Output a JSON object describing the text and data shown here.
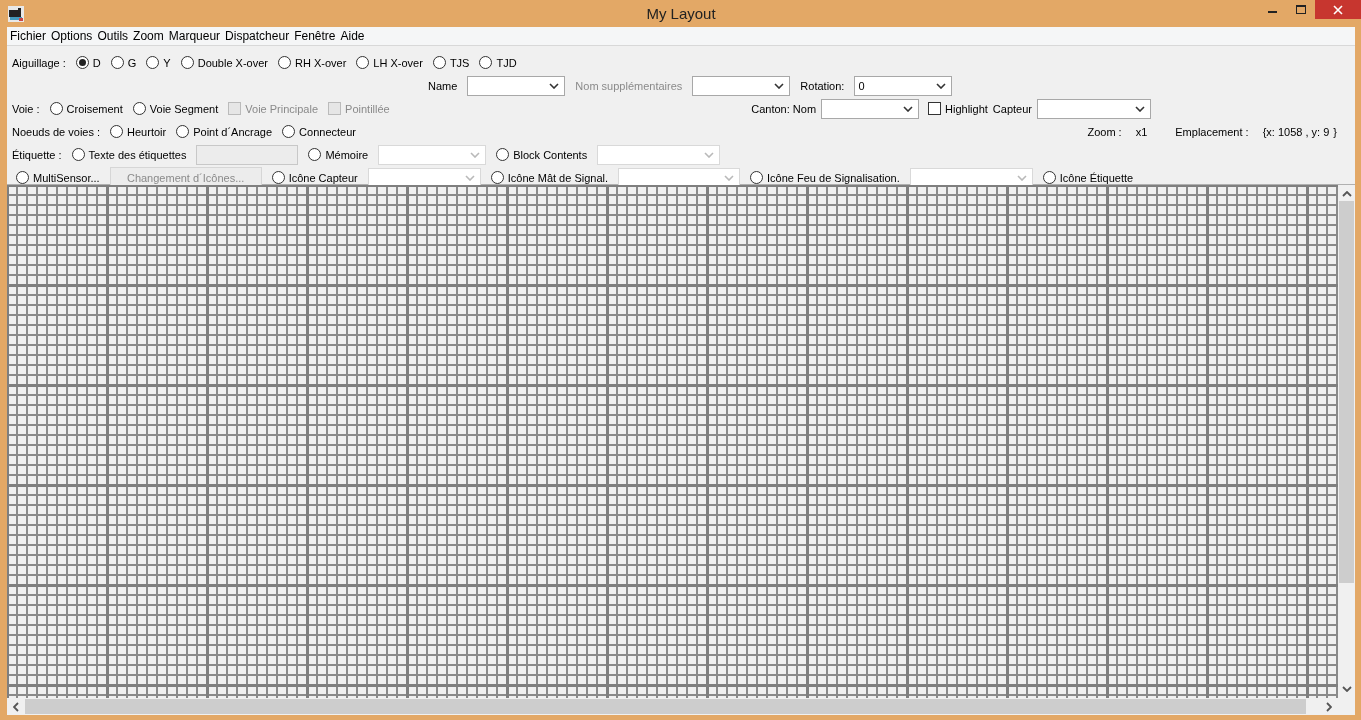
{
  "window": {
    "title": "My Layout"
  },
  "menu": [
    "Fichier",
    "Options",
    "Outils",
    "Zoom",
    "Marqueur",
    "Dispatcheur",
    "Fenêtre",
    "Aide"
  ],
  "rows": [
    {
      "left": [
        {
          "kind": "label",
          "text": "Aiguillage :",
          "disabled": false
        },
        {
          "kind": "radio",
          "label": "D",
          "selected": true
        },
        {
          "kind": "radio",
          "label": "G",
          "selected": false
        },
        {
          "kind": "radio",
          "label": "Y",
          "selected": false
        },
        {
          "kind": "radio",
          "label": "Double X-over",
          "selected": false
        },
        {
          "kind": "radio",
          "label": "RH X-over",
          "selected": false
        },
        {
          "kind": "radio",
          "label": "LH X-over",
          "selected": false
        },
        {
          "kind": "radio",
          "label": "TJS",
          "selected": false
        },
        {
          "kind": "radio",
          "label": "TJD",
          "selected": false
        }
      ],
      "right": []
    },
    {
      "left": [],
      "right": [
        {
          "kind": "label",
          "text": "Name",
          "disabled": false
        },
        {
          "kind": "combo",
          "disabled": false
        },
        {
          "kind": "label",
          "text": "Nom supplémentaires",
          "disabled": true
        },
        {
          "kind": "combo",
          "disabled": false
        },
        {
          "kind": "label",
          "text": "Rotation:",
          "disabled": false
        },
        {
          "kind": "combo",
          "disabled": false,
          "value": "0"
        }
      ]
    },
    {
      "left": [
        {
          "kind": "label",
          "text": "Voie :",
          "disabled": false
        },
        {
          "kind": "radio",
          "label": "Croisement",
          "selected": false
        },
        {
          "kind": "radio",
          "label": "Voie Segment",
          "selected": false
        },
        {
          "kind": "checkbox",
          "label": "Voie Principale",
          "checked": false,
          "disabled": true
        },
        {
          "kind": "checkbox",
          "label": "Pointillée",
          "checked": false,
          "disabled": true
        }
      ],
      "right": [
        {
          "kind": "label",
          "text": "Canton: Nom",
          "disabled": false
        },
        {
          "kind": "combo",
          "disabled": false
        },
        {
          "kind": "checkbox",
          "label": "Highlight",
          "checked": false,
          "disabled": false
        },
        {
          "kind": "label",
          "text": "Capteur",
          "disabled": false
        },
        {
          "kind": "combo",
          "disabled": false
        }
      ]
    },
    {
      "left": [
        {
          "kind": "label",
          "text": "Noeuds de voies :",
          "disabled": false
        },
        {
          "kind": "radio",
          "label": "Heurtoir",
          "selected": false
        },
        {
          "kind": "radio",
          "label": "Point d´Ancrage",
          "selected": false
        },
        {
          "kind": "radio",
          "label": "Connecteur",
          "selected": false
        }
      ],
      "right": [
        {
          "kind": "label",
          "text": "Zoom :",
          "disabled": false
        },
        {
          "kind": "label",
          "text": "x1",
          "disabled": false
        },
        {
          "kind": "label",
          "text": "Emplacement :",
          "disabled": false
        },
        {
          "kind": "label",
          "text": "{x:  1058  , y:  9",
          "disabled": false
        },
        {
          "kind": "label",
          "text": "}",
          "disabled": false
        }
      ]
    },
    {
      "left": [
        {
          "kind": "label",
          "text": "Étiquette :",
          "disabled": false
        },
        {
          "kind": "radio",
          "label": "Texte des étiquettes",
          "selected": false
        },
        {
          "kind": "textfield",
          "disabled": true
        },
        {
          "kind": "radio",
          "label": "Mémoire",
          "selected": false
        },
        {
          "kind": "combo",
          "disabled": true
        },
        {
          "kind": "radio",
          "label": "Block Contents",
          "selected": false
        },
        {
          "kind": "combo",
          "disabled": true
        }
      ],
      "right": []
    },
    {
      "left": [
        {
          "kind": "radio",
          "label": "MultiSensor...",
          "selected": false
        },
        {
          "kind": "button",
          "label": "Changement d´Icônes...",
          "disabled": true
        },
        {
          "kind": "radio",
          "label": "Icône Capteur",
          "selected": false
        },
        {
          "kind": "combo",
          "disabled": true
        },
        {
          "kind": "radio",
          "label": "Icône Mât de Signal.",
          "selected": false
        },
        {
          "kind": "combo",
          "disabled": true
        },
        {
          "kind": "radio",
          "label": "Icône Feu de Signalisation.",
          "selected": false
        },
        {
          "kind": "combo",
          "disabled": true
        },
        {
          "kind": "radio",
          "label": "Icône Étiquette",
          "selected": false
        }
      ],
      "right": []
    }
  ]
}
